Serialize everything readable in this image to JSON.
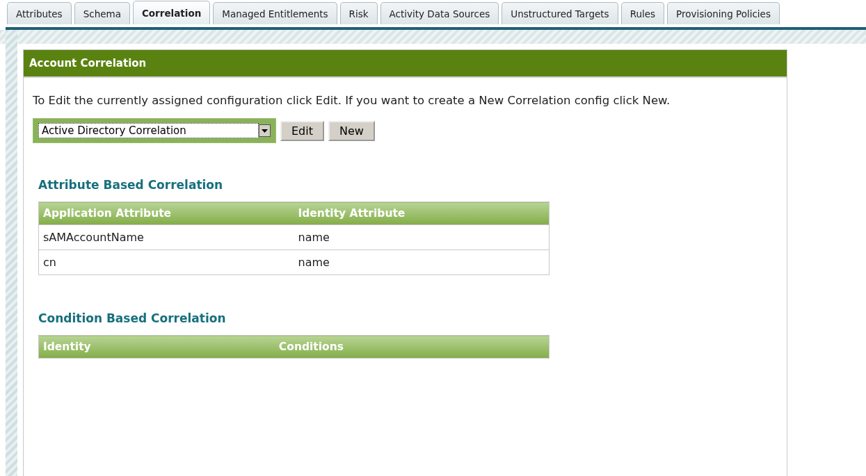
{
  "tabs": [
    {
      "label": "Attributes",
      "selected": false
    },
    {
      "label": "Schema",
      "selected": false
    },
    {
      "label": "Correlation",
      "selected": true
    },
    {
      "label": "Managed Entitlements",
      "selected": false
    },
    {
      "label": "Risk",
      "selected": false
    },
    {
      "label": "Activity Data Sources",
      "selected": false
    },
    {
      "label": "Unstructured Targets",
      "selected": false
    },
    {
      "label": "Rules",
      "selected": false
    },
    {
      "label": "Provisioning Policies",
      "selected": false
    }
  ],
  "panel": {
    "title": "Account Correlation",
    "instructions": "To Edit the currently assigned configuration click Edit. If you want to create a New Correlation config click New.",
    "config_select": {
      "value": "Active Directory Correlation"
    },
    "buttons": [
      "Edit",
      "New"
    ],
    "attribute_section": {
      "heading": "Attribute Based Correlation",
      "columns": [
        "Application Attribute",
        "Identity Attribute"
      ],
      "rows": [
        [
          "sAMAccountName",
          "name"
        ],
        [
          "cn",
          "name"
        ]
      ]
    },
    "condition_section": {
      "heading": "Condition Based Correlation",
      "columns": [
        "Identity",
        "Conditions"
      ]
    }
  }
}
